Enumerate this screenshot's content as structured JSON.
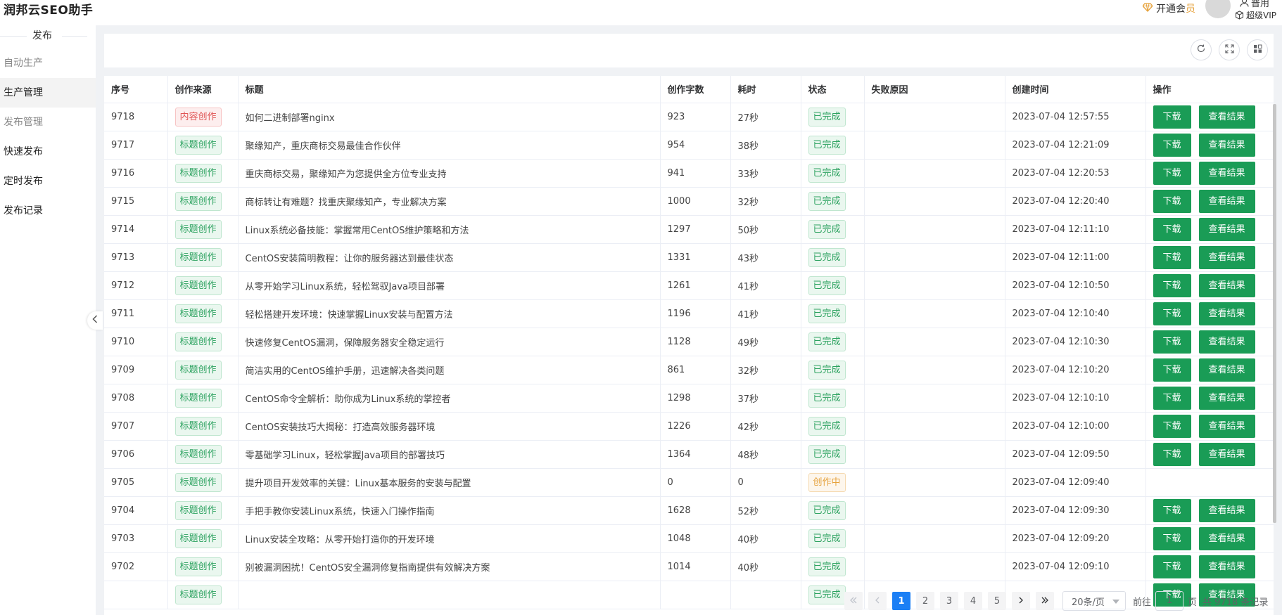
{
  "app": {
    "title": "润邦云SEO助手"
  },
  "header": {
    "vip_prefix": "开通会",
    "vip_suffix": "员",
    "user_name": "普用",
    "user_level": "超级VIP"
  },
  "sidebar": {
    "group_label": "发布",
    "items": [
      {
        "label": "自动生产",
        "state": "muted"
      },
      {
        "label": "生产管理",
        "state": "active"
      },
      {
        "label": "发布管理",
        "state": "muted"
      },
      {
        "label": "快速发布",
        "state": "normal"
      },
      {
        "label": "定时发布",
        "state": "normal"
      },
      {
        "label": "发布记录",
        "state": "normal"
      }
    ]
  },
  "table": {
    "columns": [
      "序号",
      "创作来源",
      "标题",
      "创作字数",
      "耗时",
      "状态",
      "失败原因",
      "创建时间",
      "操作"
    ],
    "download_label": "下载",
    "view_label": "查看结果",
    "rows": [
      {
        "id": "9718",
        "source": "内容创作",
        "source_type": "red",
        "title": "如何二进制部署nginx",
        "words": "923",
        "duration": "27秒",
        "status": "已完成",
        "status_type": "green",
        "reason": "",
        "created": "2023-07-04 12:57:55",
        "actions": true
      },
      {
        "id": "9717",
        "source": "标题创作",
        "source_type": "green",
        "title": "聚缘知产，重庆商标交易最佳合作伙伴",
        "words": "954",
        "duration": "38秒",
        "status": "已完成",
        "status_type": "green",
        "reason": "",
        "created": "2023-07-04 12:21:09",
        "actions": true
      },
      {
        "id": "9716",
        "source": "标题创作",
        "source_type": "green",
        "title": "重庆商标交易，聚缘知产为您提供全方位专业支持",
        "words": "941",
        "duration": "33秒",
        "status": "已完成",
        "status_type": "green",
        "reason": "",
        "created": "2023-07-04 12:20:53",
        "actions": true
      },
      {
        "id": "9715",
        "source": "标题创作",
        "source_type": "green",
        "title": "商标转让有难题？找重庆聚缘知产，专业解决方案",
        "words": "1000",
        "duration": "32秒",
        "status": "已完成",
        "status_type": "green",
        "reason": "",
        "created": "2023-07-04 12:20:40",
        "actions": true
      },
      {
        "id": "9714",
        "source": "标题创作",
        "source_type": "green",
        "title": "Linux系统必备技能：掌握常用CentOS维护策略和方法",
        "words": "1297",
        "duration": "50秒",
        "status": "已完成",
        "status_type": "green",
        "reason": "",
        "created": "2023-07-04 12:11:10",
        "actions": true
      },
      {
        "id": "9713",
        "source": "标题创作",
        "source_type": "green",
        "title": "CentOS安装简明教程：让你的服务器达到最佳状态",
        "words": "1331",
        "duration": "43秒",
        "status": "已完成",
        "status_type": "green",
        "reason": "",
        "created": "2023-07-04 12:11:00",
        "actions": true
      },
      {
        "id": "9712",
        "source": "标题创作",
        "source_type": "green",
        "title": "从零开始学习Linux系统，轻松驾驭Java项目部署",
        "words": "1261",
        "duration": "41秒",
        "status": "已完成",
        "status_type": "green",
        "reason": "",
        "created": "2023-07-04 12:10:50",
        "actions": true
      },
      {
        "id": "9711",
        "source": "标题创作",
        "source_type": "green",
        "title": "轻松搭建开发环境：快速掌握Linux安装与配置方法",
        "words": "1196",
        "duration": "41秒",
        "status": "已完成",
        "status_type": "green",
        "reason": "",
        "created": "2023-07-04 12:10:40",
        "actions": true
      },
      {
        "id": "9710",
        "source": "标题创作",
        "source_type": "green",
        "title": "快速修复CentOS漏洞，保障服务器安全稳定运行",
        "words": "1128",
        "duration": "49秒",
        "status": "已完成",
        "status_type": "green",
        "reason": "",
        "created": "2023-07-04 12:10:30",
        "actions": true
      },
      {
        "id": "9709",
        "source": "标题创作",
        "source_type": "green",
        "title": "简洁实用的CentOS维护手册，迅速解决各类问题",
        "words": "861",
        "duration": "32秒",
        "status": "已完成",
        "status_type": "green",
        "reason": "",
        "created": "2023-07-04 12:10:20",
        "actions": true
      },
      {
        "id": "9708",
        "source": "标题创作",
        "source_type": "green",
        "title": "CentOS命令全解析：助你成为Linux系统的掌控者",
        "words": "1298",
        "duration": "37秒",
        "status": "已完成",
        "status_type": "green",
        "reason": "",
        "created": "2023-07-04 12:10:10",
        "actions": true
      },
      {
        "id": "9707",
        "source": "标题创作",
        "source_type": "green",
        "title": "CentOS安装技巧大揭秘：打造高效服务器环境",
        "words": "1226",
        "duration": "42秒",
        "status": "已完成",
        "status_type": "green",
        "reason": "",
        "created": "2023-07-04 12:10:00",
        "actions": true
      },
      {
        "id": "9706",
        "source": "标题创作",
        "source_type": "green",
        "title": "零基础学习Linux，轻松掌握Java项目的部署技巧",
        "words": "1364",
        "duration": "48秒",
        "status": "已完成",
        "status_type": "green",
        "reason": "",
        "created": "2023-07-04 12:09:50",
        "actions": true
      },
      {
        "id": "9705",
        "source": "标题创作",
        "source_type": "green",
        "title": "提升项目开发效率的关键：Linux基本服务的安装与配置",
        "words": "0",
        "duration": "0",
        "status": "创作中",
        "status_type": "orange",
        "reason": "",
        "created": "2023-07-04 12:09:40",
        "actions": false
      },
      {
        "id": "9704",
        "source": "标题创作",
        "source_type": "green",
        "title": "手把手教你安装Linux系统，快速入门操作指南",
        "words": "1628",
        "duration": "52秒",
        "status": "已完成",
        "status_type": "green",
        "reason": "",
        "created": "2023-07-04 12:09:30",
        "actions": true
      },
      {
        "id": "9703",
        "source": "标题创作",
        "source_type": "green",
        "title": "Linux安装全攻略：从零开始打造你的开发环境",
        "words": "1048",
        "duration": "40秒",
        "status": "已完成",
        "status_type": "green",
        "reason": "",
        "created": "2023-07-04 12:09:20",
        "actions": true
      },
      {
        "id": "9702",
        "source": "标题创作",
        "source_type": "green",
        "title": "别被漏洞困扰！CentOS安全漏洞修复指南提供有效解决方案",
        "words": "1014",
        "duration": "40秒",
        "status": "已完成",
        "status_type": "green",
        "reason": "",
        "created": "2023-07-04 12:09:10",
        "actions": true
      },
      {
        "id": "",
        "source": "标题创作",
        "source_type": "green",
        "title": "",
        "words": "",
        "duration": "",
        "status": "已完成",
        "status_type": "green",
        "reason": "",
        "created": "",
        "actions": true
      }
    ]
  },
  "pagination": {
    "pages": [
      "1",
      "2",
      "3",
      "4",
      "5"
    ],
    "current": "1",
    "page_size": "20条/页",
    "goto_prefix": "前往",
    "goto_value": "1",
    "goto_suffix": "页",
    "total_text": "共 9718 条记录"
  },
  "colors": {
    "primary_green": "#1a9c56",
    "active_blue": "#1b7ff5",
    "warning_orange": "#e6a23c",
    "danger_red": "#e05555"
  }
}
